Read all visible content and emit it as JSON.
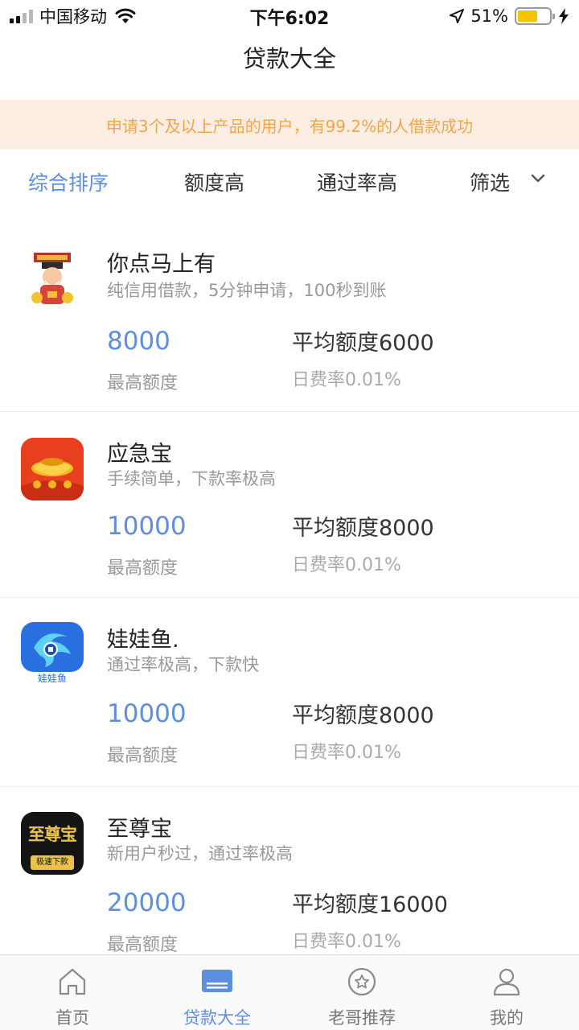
{
  "status_bar": {
    "carrier": "中国移动",
    "time": "下午6:02",
    "battery": "51%"
  },
  "nav": {
    "title": "贷款大全"
  },
  "notice": {
    "text": "申请3个及以上产品的用户，有99.2%的人借款成功"
  },
  "sort": {
    "items": [
      {
        "label": "综合排序",
        "active": true
      },
      {
        "label": "额度高",
        "active": false
      },
      {
        "label": "通过率高",
        "active": false
      },
      {
        "label": "筛选",
        "active": false
      }
    ]
  },
  "loans": [
    {
      "name": "你点马上有",
      "desc": "纯信用借款，5分钟申请，100秒到账",
      "max_amount": "8000",
      "max_label": "最高额度",
      "avg": "平均额度6000",
      "rate": "日费率0.01%",
      "icon": "fortune-god-icon"
    },
    {
      "name": "应急宝",
      "desc": "手续简单，下款率极高",
      "max_amount": "10000",
      "max_label": "最高额度",
      "avg": "平均额度8000",
      "rate": "日费率0.01%",
      "icon": "gold-ingot-icon"
    },
    {
      "name": "娃娃鱼.",
      "desc": "通过率极高，下款快",
      "max_amount": "10000",
      "max_label": "最高额度",
      "avg": "平均额度8000",
      "rate": "日费率0.01%",
      "icon": "fish-coin-icon",
      "icon_text": "娃娃鱼"
    },
    {
      "name": "至尊宝",
      "desc": "新用户秒过，通过率极高",
      "max_amount": "20000",
      "max_label": "最高额度",
      "avg": "平均额度16000",
      "rate": "日费率0.01%",
      "icon": "zhizunbao-logo-icon",
      "icon_text": "至尊宝",
      "icon_subtext": "极速下款"
    }
  ],
  "tabs": [
    {
      "label": "首页",
      "icon": "home-icon",
      "active": false
    },
    {
      "label": "贷款大全",
      "icon": "loan-list-icon",
      "active": true
    },
    {
      "label": "老哥推荐",
      "icon": "star-circle-icon",
      "active": false
    },
    {
      "label": "我的",
      "icon": "user-icon",
      "active": false
    }
  ],
  "colors": {
    "accent": "#5c8fdf",
    "notice_bg": "#fdeee4",
    "notice_text": "#f5a44a"
  }
}
